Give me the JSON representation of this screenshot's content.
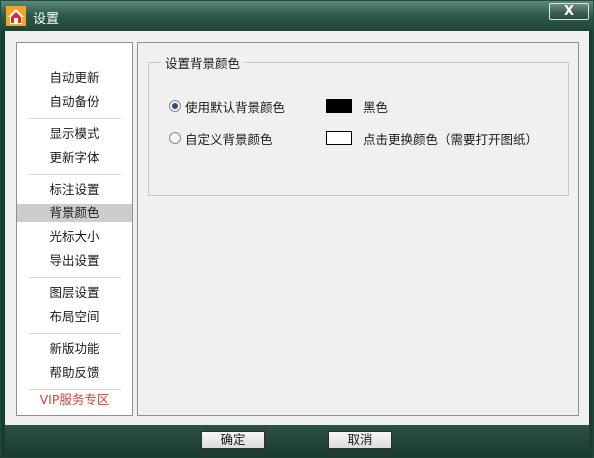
{
  "window": {
    "title": "设置",
    "close_label": "X"
  },
  "sidebar": {
    "items": [
      {
        "label": "自动更新"
      },
      {
        "label": "自动备份"
      },
      {
        "label": "显示模式"
      },
      {
        "label": "更新字体"
      },
      {
        "label": "标注设置"
      },
      {
        "label": "背景颜色",
        "active": true
      },
      {
        "label": "光标大小"
      },
      {
        "label": "导出设置"
      },
      {
        "label": "图层设置"
      },
      {
        "label": "布局空间"
      },
      {
        "label": "新版功能"
      },
      {
        "label": "帮助反馈"
      },
      {
        "label": "VIP服务专区",
        "color": "#c8463a"
      }
    ]
  },
  "panel": {
    "group_title": "设置背景颜色",
    "options": [
      {
        "label": "使用默认背景颜色",
        "selected": true,
        "swatch_color": "#000000",
        "swatch_label": "黑色"
      },
      {
        "label": "自定义背景颜色",
        "selected": false,
        "swatch_color": "#ffffff",
        "swatch_label": "点击更换颜色（需要打开图纸）"
      }
    ]
  },
  "footer": {
    "ok_label": "确定",
    "cancel_label": "取消"
  },
  "colors": {
    "titlebar": "#2f5a4d",
    "active_item_bg": "#cdcdcd",
    "vip_text": "#c8463a",
    "radio_dot": "#2b4d8c"
  }
}
